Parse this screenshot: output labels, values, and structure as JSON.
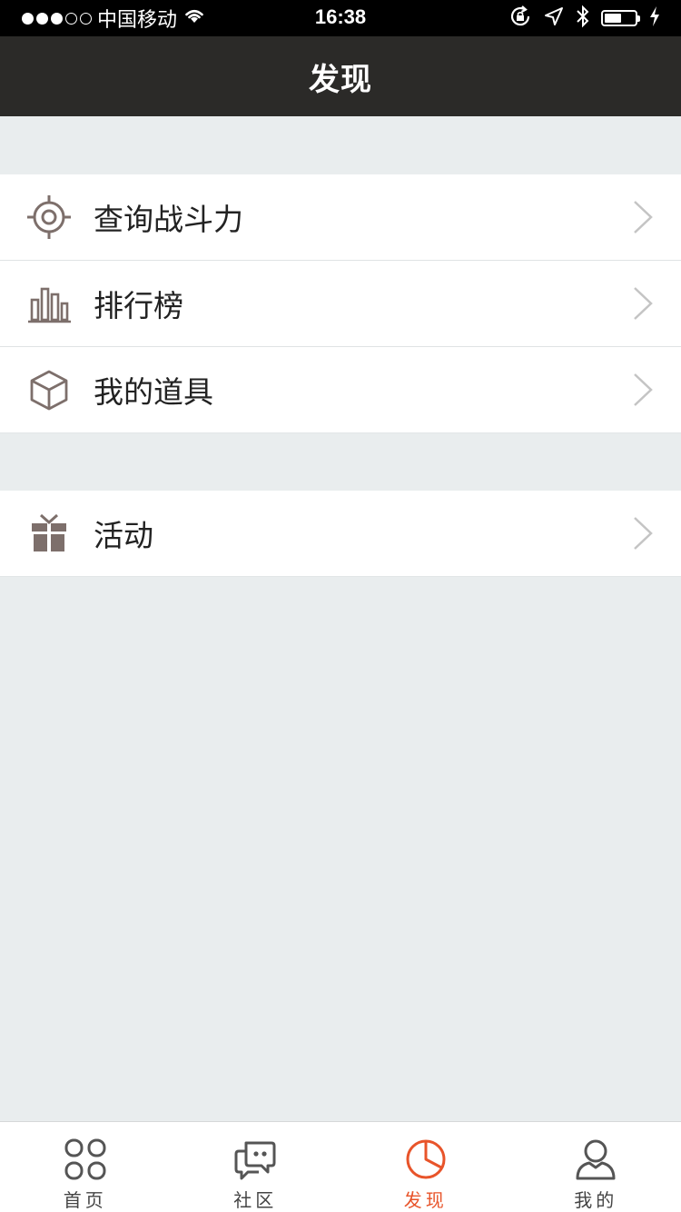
{
  "status_bar": {
    "carrier": "中国移动",
    "time": "16:38",
    "signal_filled": 3,
    "signal_total": 5,
    "battery_level": 0.55
  },
  "nav": {
    "title": "发现"
  },
  "groups": [
    {
      "items": [
        {
          "label": "查询战斗力",
          "icon": "target-icon"
        },
        {
          "label": "排行榜",
          "icon": "bar-chart-icon"
        },
        {
          "label": "我的道具",
          "icon": "cube-icon"
        }
      ]
    },
    {
      "items": [
        {
          "label": "活动",
          "icon": "gift-icon"
        }
      ]
    }
  ],
  "tabs": [
    {
      "label": "首页",
      "icon": "grid-icon",
      "active": false
    },
    {
      "label": "社区",
      "icon": "chat-icon",
      "active": false
    },
    {
      "label": "发现",
      "icon": "pie-icon",
      "active": true
    },
    {
      "label": "我的",
      "icon": "user-icon",
      "active": false
    }
  ],
  "colors": {
    "navbar_bg": "#2b2a28",
    "icon": "#7d6f6b",
    "accent": "#e8542a",
    "page_bg": "#e9edee"
  }
}
